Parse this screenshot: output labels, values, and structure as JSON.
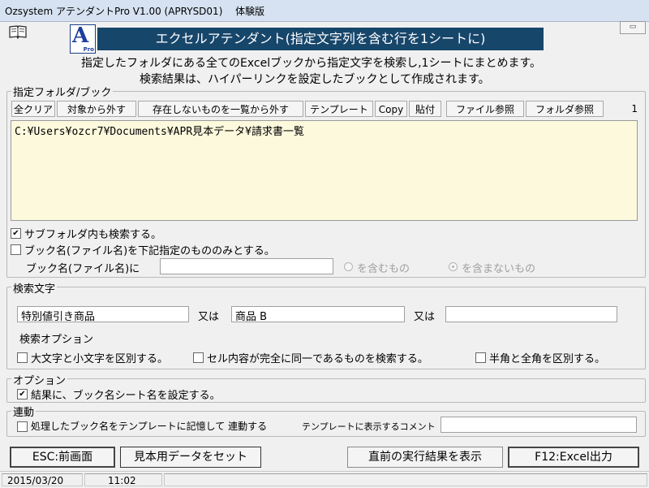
{
  "window": {
    "title": "Ozsystem アテンダントPro V1.00 (APRYSD01)　 体験版",
    "corner_button": "▭"
  },
  "header": {
    "logo_letter": "A",
    "logo_sub": "Pro",
    "banner": "エクセルアテンダント(指定文字列を含む行を1シートに)",
    "desc_line1": "指定したフォルダにある全てのExcelブックから指定文字を検索し,1シートにまとめます。",
    "desc_line2": "検索結果は、ハイパーリンクを設定したブックとして作成されます。"
  },
  "folder_group": {
    "legend": "指定フォルダ/ブック",
    "toolbar": {
      "clear_all": "全クリア",
      "remove_target": "対象から外す",
      "remove_missing": "存在しないものを一覧から外す",
      "template": "テンプレート",
      "copy": "Copy",
      "paste": "貼付",
      "file_browse": "ファイル参照",
      "folder_browse": "フォルダ参照"
    },
    "count": "1",
    "paths": "C:¥Users¥ozcr7¥Documents¥APR見本データ¥請求書一覧",
    "subfolder_label": "サブフォルダ内も検索する。",
    "subfolder_checked": true,
    "bookname_only_label": "ブック名(ファイル名)を下記指定のもののみとする。",
    "bookname_only_checked": false,
    "bookname_prefix": "ブック名(ファイル名)に",
    "bookname_value": "",
    "radio_include": "を含むもの",
    "radio_exclude": "を含まないもの"
  },
  "search_group": {
    "legend": "検索文字",
    "term1": "特別値引き商品",
    "or1": "又は",
    "term2": "商品 B",
    "or2": "又は",
    "term3": "",
    "options_title": "検索オプション",
    "opt_case": "大文字と小文字を区別する。",
    "opt_exact": "セル内容が完全に同一であるものを検索する。",
    "opt_width": "半角と全角を区別する。"
  },
  "option_group": {
    "legend": "オプション",
    "set_names_label": "結果に、ブック名シート名を設定する。",
    "set_names_checked": true
  },
  "link_group": {
    "legend": "連動",
    "remember_label": "処理したブック名をテンプレートに記憶して 連動する",
    "comment_label": "テンプレートに表示するコメント",
    "comment_value": ""
  },
  "buttons": {
    "esc": "ESC:前画面",
    "sample": "見本用データをセット",
    "show_prev": "直前の実行結果を表示",
    "f12": "F12:Excel出力"
  },
  "status": {
    "date": "2015/03/20",
    "time": "11:02"
  }
}
